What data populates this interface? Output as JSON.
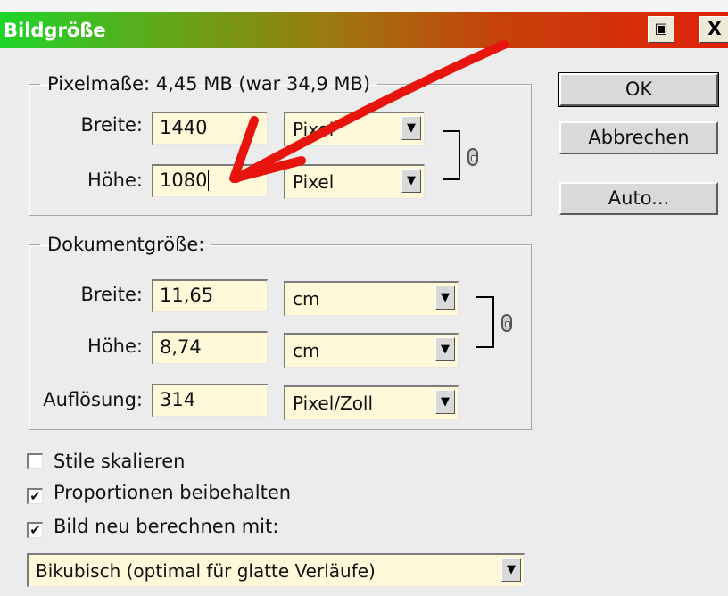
{
  "window": {
    "title": "Bildgröße",
    "help_icon": "camera-icon",
    "close_label": "X"
  },
  "pixel_dimensions": {
    "legend": "Pixelmaße: 4,45 MB (war 34,9 MB)",
    "width_label": "Breite:",
    "width_value": "1440",
    "width_unit": "Pixel",
    "height_label": "Höhe:",
    "height_value": "1080",
    "height_unit": "Pixel",
    "link_icon": "chain-link-icon"
  },
  "document_size": {
    "legend": "Dokumentgröße:",
    "width_label": "Breite:",
    "width_value": "11,65",
    "width_unit": "cm",
    "height_label": "Höhe:",
    "height_value": "8,74",
    "height_unit": "cm",
    "resolution_label": "Auflösung:",
    "resolution_value": "314",
    "resolution_unit": "Pixel/Zoll",
    "link_icon": "chain-link-icon"
  },
  "buttons": {
    "ok": "OK",
    "cancel": "Abbrechen",
    "auto": "Auto..."
  },
  "options": {
    "scale_styles": {
      "label": "Stile skalieren",
      "checked": false
    },
    "constrain_proportions": {
      "label": "Proportionen beibehalten",
      "checked": true
    },
    "resample": {
      "label": "Bild neu berechnen mit:",
      "checked": true
    }
  },
  "resample_method": {
    "value": "Bikubisch (optimal für glatte Verläufe)"
  },
  "annotation": {
    "arrow_color": "#e8140e"
  },
  "glyphs": {
    "check": "✔",
    "dropdown": "▼"
  }
}
